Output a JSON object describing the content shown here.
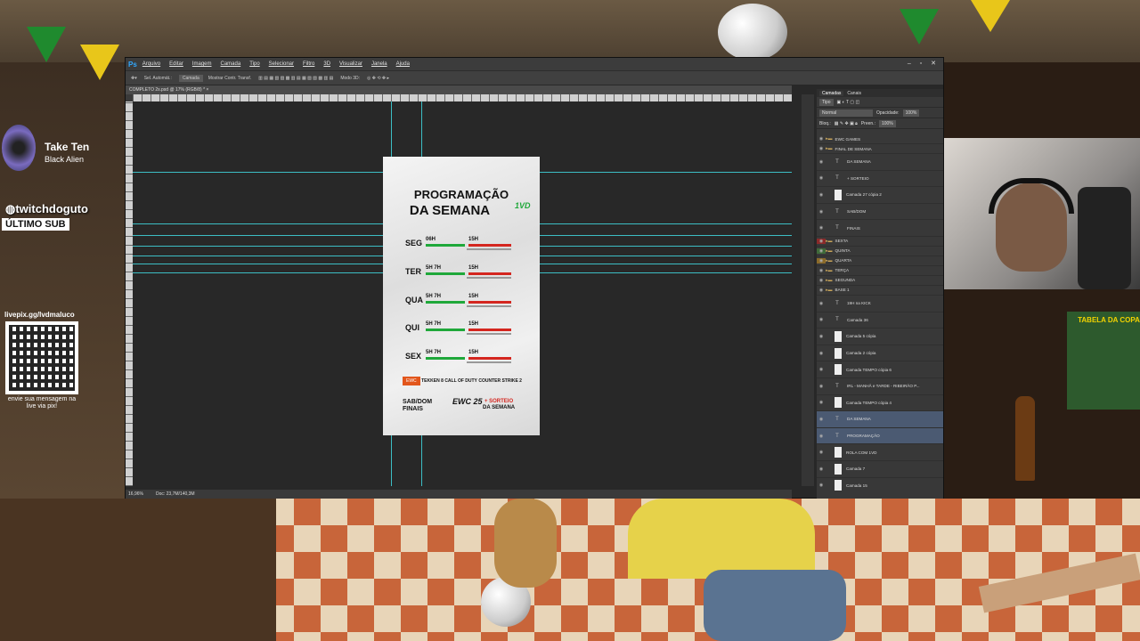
{
  "overlay": {
    "now_playing": {
      "title": "Take Ten",
      "artist": "Black Alien"
    },
    "last_sub": {
      "name": "twitchdoguto",
      "label": "ÚLTIMO SUB"
    },
    "pix": {
      "url": "livepix.gg/lvdmaluco",
      "message": "envie sua mensagem na live via pix!"
    },
    "wall_sign": "TABELA DA COPA"
  },
  "photoshop": {
    "logo": "Ps",
    "menu": [
      "Arquivo",
      "Editar",
      "Imagem",
      "Camada",
      "Tipo",
      "Selecionar",
      "Filtro",
      "3D",
      "Visualizar",
      "Janela",
      "Ajuda"
    ],
    "window_buttons": "– ▫ ✕",
    "options": {
      "auto_select": "Sel. Automát.:",
      "layer_mode": "Camada",
      "transform": "Mostrar Contr. Transf.",
      "mode_3d": "Modo 3D:"
    },
    "doc_tab": "COMPLETO 2s.psd @ 17% (RGB/8) * ×",
    "status": {
      "zoom": "16,96%",
      "doc": "Doc: 23,7M/140,3M"
    },
    "layers_panel": {
      "tabs": [
        "Camadas",
        "Canais"
      ],
      "kind": "Tipo",
      "blend": "Normal",
      "opacity_label": "Opacidade:",
      "opacity_value": "100%",
      "lock_label": "Bloq.:",
      "fill_label": "Preen.:",
      "fill_value": "100%",
      "layers": [
        {
          "name": "EWC GAMES",
          "type": "folder"
        },
        {
          "name": "FINAL DE SEMANA",
          "type": "folder"
        },
        {
          "name": "DA SEMANA",
          "type": "text"
        },
        {
          "name": "+ SORTEIO",
          "type": "text"
        },
        {
          "name": "Camada 27 cópia 2",
          "type": "image"
        },
        {
          "name": "SAB/DOM",
          "type": "text"
        },
        {
          "name": "FINAIS",
          "type": "text"
        },
        {
          "name": "SEXTA",
          "type": "folder"
        },
        {
          "name": "QUINTA",
          "type": "folder"
        },
        {
          "name": "QUARTA",
          "type": "folder"
        },
        {
          "name": "TERÇA",
          "type": "folder"
        },
        {
          "name": "SEGUNDA",
          "type": "folder"
        },
        {
          "name": "BASE 1",
          "type": "folder"
        },
        {
          "name": "19H na KICK",
          "type": "text"
        },
        {
          "name": "Camada 36",
          "type": "text"
        },
        {
          "name": "Camada 5 cópia",
          "type": "image"
        },
        {
          "name": "Camada 2 cópia",
          "type": "image"
        },
        {
          "name": "Camada TEMPO cópia 6",
          "type": "image"
        },
        {
          "name": "IRL - MANHÃ e TARDE - RIBEIRÃO P...",
          "type": "text"
        },
        {
          "name": "Camada TEMPO cópia 4",
          "type": "image"
        },
        {
          "name": "DA SEMANA",
          "type": "text"
        },
        {
          "name": "PROGRAMAÇÃO",
          "type": "text"
        },
        {
          "name": "ROLA COM 1VD",
          "type": "image"
        },
        {
          "name": "Camada 7",
          "type": "image"
        },
        {
          "name": "Camada 15",
          "type": "image"
        }
      ]
    }
  },
  "poster": {
    "title_line1": "PROGRAMAÇÃO",
    "title_line2": "DA SEMANA",
    "logo": "1VD",
    "days": [
      {
        "day": "SEG",
        "time_a": "06H",
        "time_b": "15H"
      },
      {
        "day": "TER",
        "time_a": "5H  7H",
        "time_b": "15H"
      },
      {
        "day": "QUA",
        "time_a": "5H  7H",
        "time_b": "15H"
      },
      {
        "day": "QUI",
        "time_a": "5H  7H",
        "time_b": "15H"
      },
      {
        "day": "SEX",
        "time_a": "5H  7H",
        "time_b": "15H"
      }
    ],
    "games": [
      "EWC",
      "TEKKEN 8",
      "CALL OF DUTY",
      "COUNTER STRIKE 2"
    ],
    "final_days": "SAB/DOM",
    "final_label": "FINAIS",
    "ewc_label": "EWC 25",
    "sorteio_line1": "+ SORTEIO",
    "sorteio_line2": "DA SEMANA"
  },
  "colors": {
    "guide": "#3fd8e0",
    "ps_blue": "#31a8ff",
    "green": "#1fa83a",
    "red": "#d4261f",
    "orange": "#e2561c"
  }
}
